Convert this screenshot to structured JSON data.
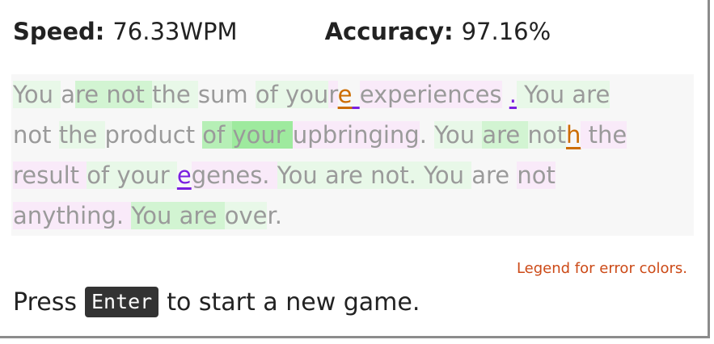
{
  "stats": {
    "speed_label": "Speed:",
    "speed_value": "76.33WPM",
    "accuracy_label": "Accuracy:",
    "accuracy_value": "97.16%"
  },
  "passage": {
    "lines": [
      [
        {
          "t": "You ",
          "s": "g1"
        },
        {
          "t": "a",
          "s": ""
        },
        {
          "t": "re ",
          "s": "g2"
        },
        {
          "t": "not ",
          "s": "g2"
        },
        {
          "t": "the ",
          "s": "g1"
        },
        {
          "t": "sum ",
          "s": ""
        },
        {
          "t": "of ",
          "s": "g1"
        },
        {
          "t": "you",
          "s": "g1"
        },
        {
          "t": "r",
          "s": "p1"
        },
        {
          "t": "e",
          "s": "err-orange"
        },
        {
          "t": " ",
          "s": "err-purple"
        },
        {
          "t": "experiences",
          "s": "p1"
        },
        {
          "t": " ",
          "s": ""
        },
        {
          "t": ".",
          "s": "err-purple"
        },
        {
          "t": " You ",
          "s": "g1"
        },
        {
          "t": "are",
          "s": "g1"
        }
      ],
      [
        {
          "t": "not ",
          "s": ""
        },
        {
          "t": "the ",
          "s": "g1"
        },
        {
          "t": "product ",
          "s": ""
        },
        {
          "t": "of ",
          "s": "g3"
        },
        {
          "t": "your ",
          "s": "g4"
        },
        {
          "t": "upbringing",
          "s": "p1"
        },
        {
          "t": ". ",
          "s": ""
        },
        {
          "t": "You ",
          "s": "g1"
        },
        {
          "t": "are ",
          "s": "g2"
        },
        {
          "t": "not",
          "s": "g1"
        },
        {
          "t": "h",
          "s": "err-orange"
        },
        {
          "t": " the",
          "s": "p1"
        }
      ],
      [
        {
          "t": "result ",
          "s": "p1"
        },
        {
          "t": "of ",
          "s": "g1"
        },
        {
          "t": "your ",
          "s": "g1"
        },
        {
          "t": "e",
          "s": "err-purple"
        },
        {
          "t": "genes. ",
          "s": "p1"
        },
        {
          "t": "You ",
          "s": "g1"
        },
        {
          "t": "are ",
          "s": "g1"
        },
        {
          "t": "not. ",
          "s": "g1"
        },
        {
          "t": "You ",
          "s": "g1"
        },
        {
          "t": "are ",
          "s": ""
        },
        {
          "t": "not",
          "s": "p1"
        }
      ],
      [
        {
          "t": "anything. ",
          "s": "p1"
        },
        {
          "t": "You ",
          "s": "g2"
        },
        {
          "t": "are ",
          "s": "g2"
        },
        {
          "t": "ove",
          "s": "g1"
        },
        {
          "t": "r.",
          "s": ""
        }
      ]
    ]
  },
  "legend": {
    "label": "Legend for error colors."
  },
  "prompt": {
    "before": "Press",
    "key": "Enter",
    "after": "to start a new game."
  },
  "colors": {
    "error_orange": "#cc6d00",
    "error_purple": "#7a1fe0",
    "legend_link": "#cc4a17",
    "correct_green": "#9eea9e",
    "miss_pink": "#f3dcf3"
  }
}
